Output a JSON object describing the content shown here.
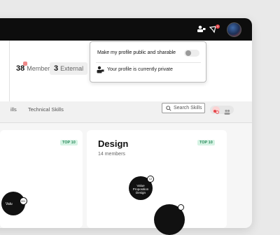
{
  "header": {
    "members_count": "38",
    "members_label": "Members",
    "external_count": "3",
    "external_label": "External"
  },
  "tabs": {
    "skills": "ills",
    "technical": "Technical Skills"
  },
  "search": {
    "placeholder": "Search Skills"
  },
  "popover": {
    "public_label": "Make my profile public and sharable",
    "status_text": "Your profile is currently private"
  },
  "notifications": {
    "count": "4"
  },
  "cards": [
    {
      "badge": "TOP 10",
      "bubble_label": "Valu",
      "mini_value": "99+"
    },
    {
      "title": "Design",
      "members": "14 members",
      "badge": "TOP 10",
      "bubble_label": "Value Proposition Design",
      "mini_value": "12"
    }
  ],
  "colors": {
    "accent_badge": "#d6f3e4",
    "notif": "#e5484d",
    "topbar": "#0d0d0d"
  }
}
